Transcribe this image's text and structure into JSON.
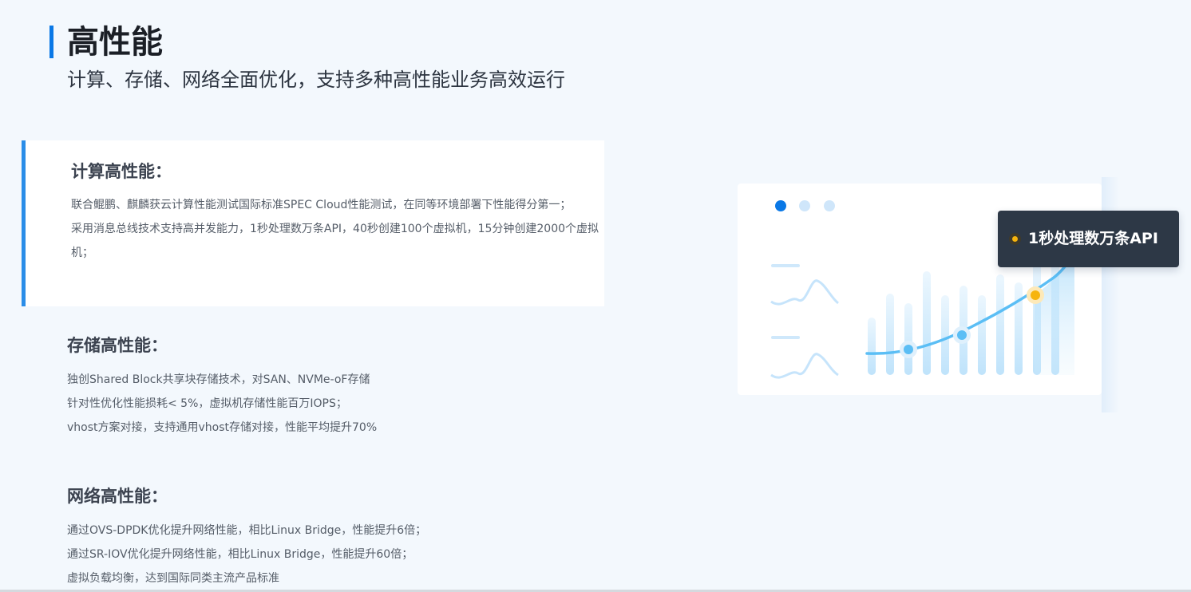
{
  "header": {
    "title": "高性能",
    "subtitle": "计算、存储、网络全面优化，支持多种高性能业务高效运行"
  },
  "sections": [
    {
      "title": "计算高性能：",
      "lines": [
        "联合鲲鹏、麒麟获云计算性能测试国际标准SPEC Cloud性能测试，在同等环境部署下性能得分第一；",
        "采用消息总线技术支持高并发能力，1秒处理数万条API，40秒创建100个虚拟机，15分钟创建2000个虚拟机；"
      ]
    },
    {
      "title": "存储高性能：",
      "lines": [
        "独创Shared Block共享块存储技术，对SAN、NVMe-oF存储",
        "针对性优化性能损耗< 5%，虚拟机存储性能百万IOPS；",
        "vhost方案对接，支持通用vhost存储对接，性能平均提升70%"
      ]
    },
    {
      "title": "网络高性能：",
      "lines": [
        "通过OVS-DPDK优化提升网络性能，相比Linux Bridge，性能提升6倍；",
        "通过SR-IOV优化提升网络性能，相比Linux Bridge，性能提升60倍；",
        "虚拟负载均衡，达到国际同类主流产品标准"
      ]
    }
  ],
  "illustration": {
    "tooltip": "1秒处理数万条API",
    "icons": [
      "pager-dots-icon",
      "wave-line-icon",
      "bar-chart-icon",
      "trend-curve-icon"
    ],
    "colors": {
      "accent": "#0a78e6",
      "curve": "#5bbef5",
      "highlight": "#f6b40e",
      "tooltip_bg": "#2d3846"
    }
  }
}
